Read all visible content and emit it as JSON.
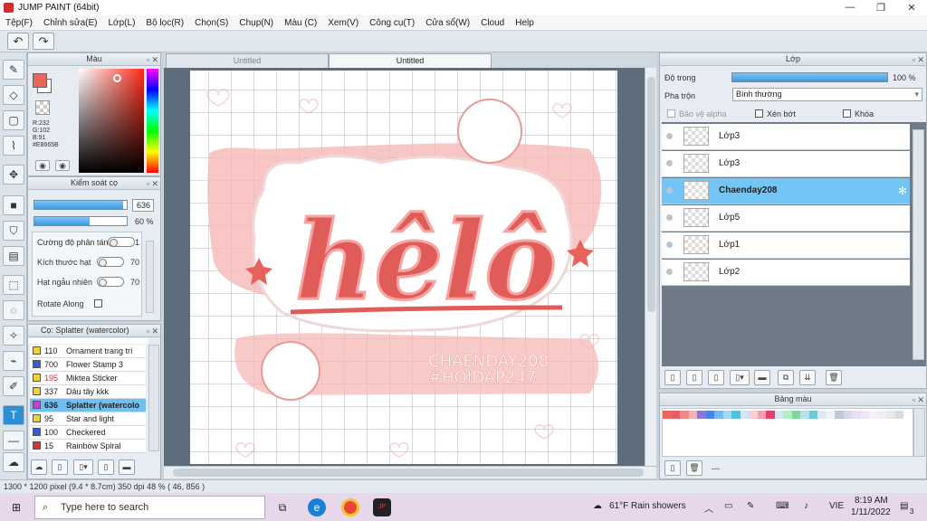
{
  "window": {
    "title": "JUMP PAINT (64bit)",
    "min": "—",
    "max": "❐",
    "close": "✕"
  },
  "menu": [
    "Tệp(F)",
    "Chỉnh sửa(E)",
    "Lớp(L)",
    "Bộ lọc(R)",
    "Chọn(S)",
    "Chụp(N)",
    "Màu (C)",
    "Xem(V)",
    "Công cụ(T)",
    "Cửa sổ(W)",
    "Cloud",
    "Help"
  ],
  "color_panel": {
    "title": "Màu",
    "r": "R:232",
    "g": "G:102",
    "b": "B:91",
    "hex": "#E8665B",
    "primary": "#E8665B"
  },
  "brush_control": {
    "title": "Kiểm soát cọ",
    "size": "636",
    "opacity": "60 %",
    "size_fraction": 0.96,
    "opacity_fraction": 0.6,
    "scatter_label": "Cường độ phân tán",
    "scatter_val": "1",
    "particle_label": "Kích thước hạt",
    "particle_val": "70",
    "random_label": "Hạt ngẫu nhiên",
    "random_val": "70",
    "rotate_label": "Rotate Along"
  },
  "brush_list": {
    "title": "Cọ: Splatter (watercolor)",
    "items": [
      {
        "n": "110",
        "t": "Ornament trang trí",
        "c": "#f0d42a"
      },
      {
        "n": "700",
        "t": "Flower Stamp 3",
        "c": "#3a5bd6"
      },
      {
        "n": "195",
        "t": "Miktea Sticker",
        "c": "#f0d42a",
        "red": true
      },
      {
        "n": "337",
        "t": "Dâu tây kkk",
        "c": "#f0d42a"
      },
      {
        "n": "636",
        "t": "Splatter (watercolo",
        "c": "#c73fd6",
        "sel": true
      },
      {
        "n": "95",
        "t": "Star and light",
        "c": "#f0d42a"
      },
      {
        "n": "100",
        "t": "Checkered",
        "c": "#3a5bd6"
      },
      {
        "n": "15",
        "t": "Rainbow Spiral",
        "c": "#e23030"
      }
    ]
  },
  "tabs": [
    "Untitled",
    "Untitled"
  ],
  "artwork": {
    "main": "hêlô",
    "line1": "CHAENDAY208",
    "line2": "#HOIDAP247"
  },
  "layer_panel": {
    "title": "Lớp",
    "opacity_label": "Độ trong",
    "opacity_val": "100 %",
    "blend_label": "Pha trộn",
    "blend_val": "Bình thường",
    "alpha_label": "Bảo vệ alpha",
    "clip_label": "Xén bớt",
    "lock_label": "Khóa",
    "layers": [
      {
        "name": "Lớp3"
      },
      {
        "name": "Lớp3"
      },
      {
        "name": "Chaenday208",
        "sel": true
      },
      {
        "name": "Lớp5"
      },
      {
        "name": "Lớp1"
      },
      {
        "name": "Lớp2"
      }
    ]
  },
  "palette": {
    "title": "Bảng màu",
    "footer": "---",
    "colors": [
      "#e8665b",
      "#e35d6a",
      "#f08a8a",
      "#f4b1b1",
      "#8a7ad8",
      "#4a86e0",
      "#7ab6f0",
      "#a8d8f0",
      "#56c0e0",
      "#cfe9f4",
      "#f8d0d8",
      "#f5a0b0",
      "#e84070",
      "#d8e4f0",
      "#b0f0c0",
      "#80d8a0",
      "#b8e0e8",
      "#70c8d8",
      "#e0e8f0",
      "#f0f4f8",
      "#c0c8d8",
      "#d8d8e8",
      "#e8e0f0",
      "#f0e8f8",
      "#f8f0f8",
      "#f0f0f0",
      "#e8e8e8",
      "#dcdcdc"
    ]
  },
  "status": "1300 * 1200 pixel   (9.4 * 8.7cm)   350 dpi   48 %   ( 46, 856 )",
  "taskbar": {
    "search": "Type here to search",
    "weather": "61°F  Rain showers",
    "lang": "VIE",
    "time": "8:19 AM",
    "date": "1/11/2022",
    "notif": "3"
  }
}
